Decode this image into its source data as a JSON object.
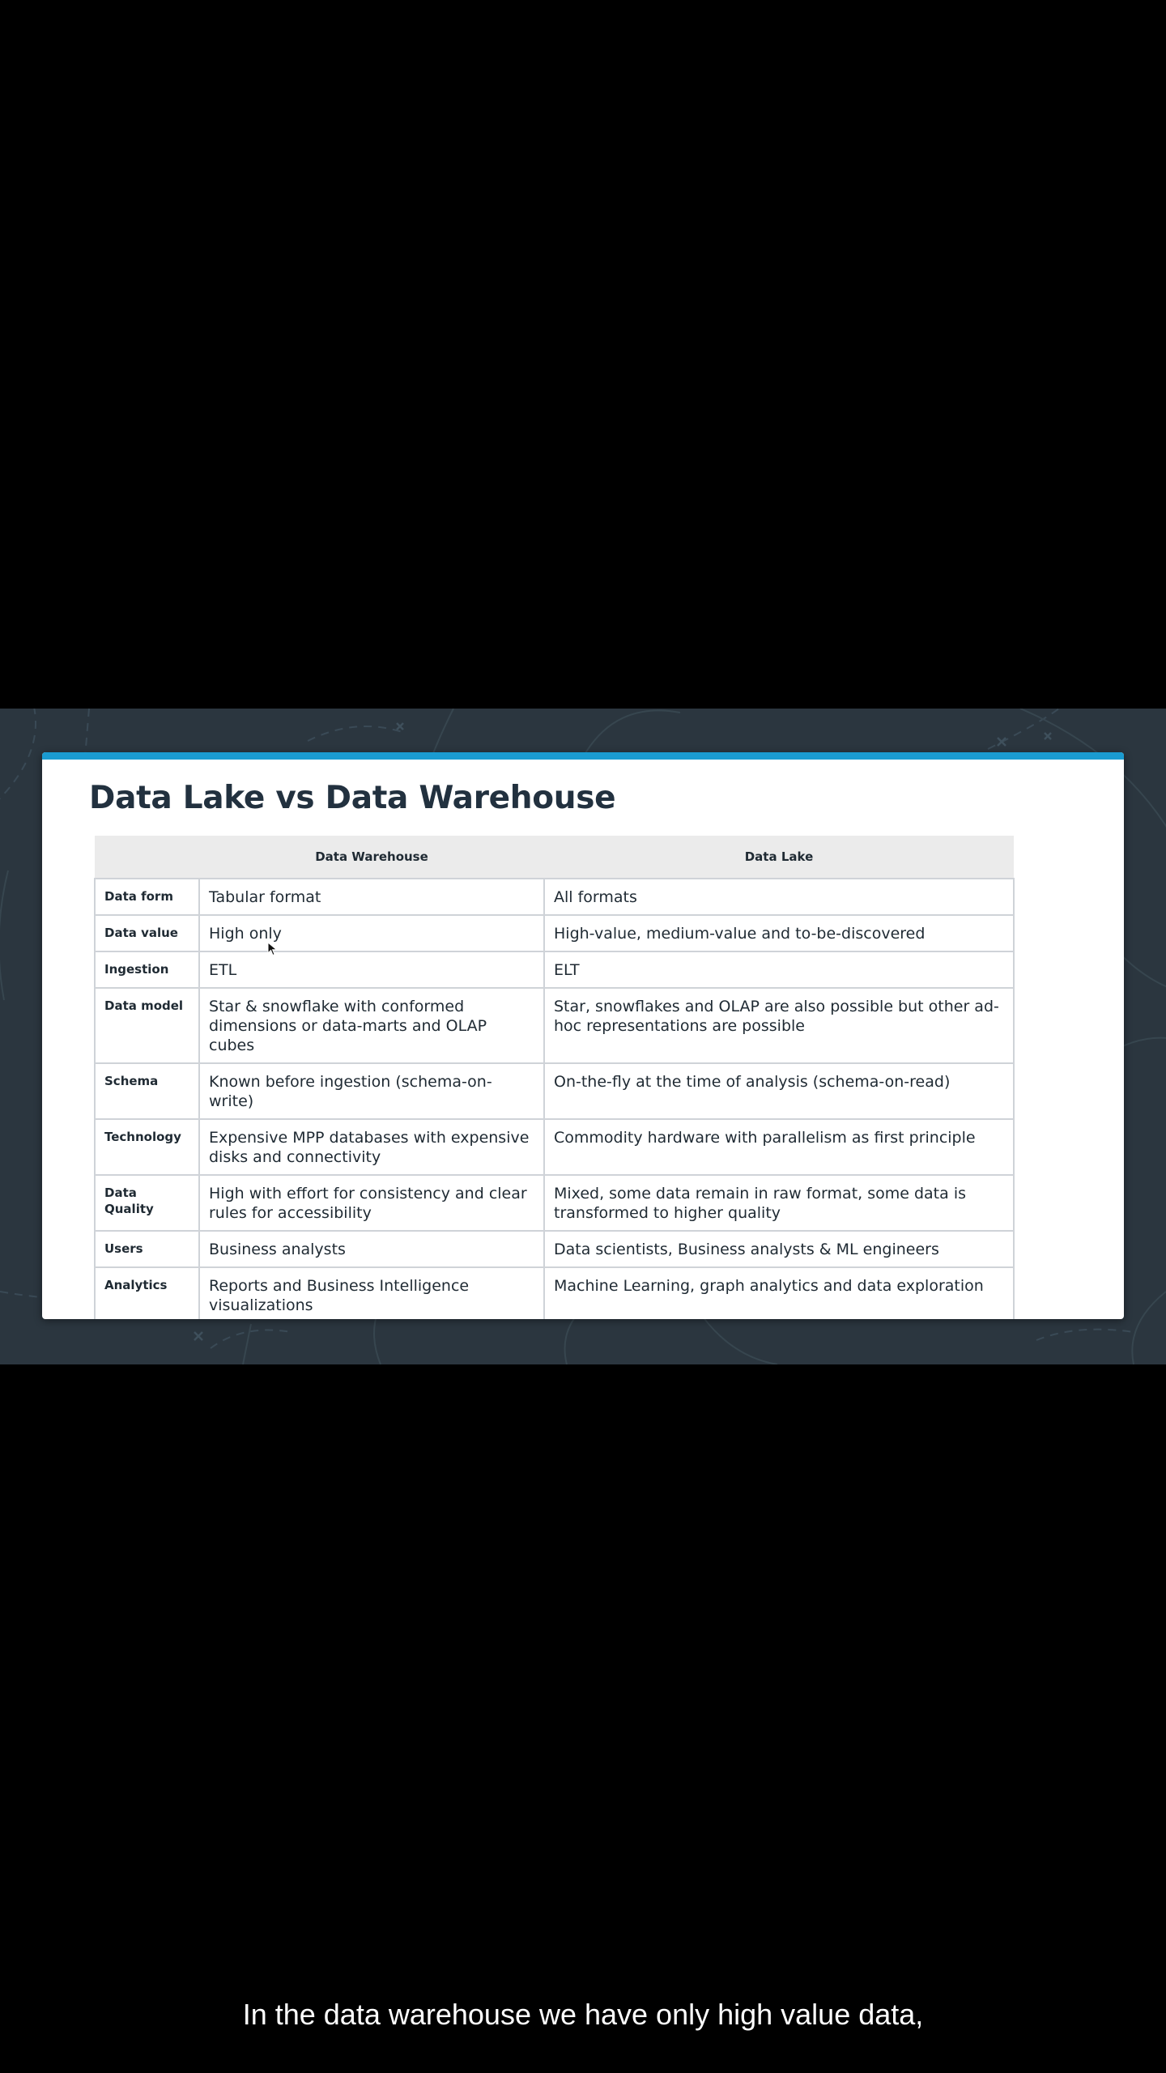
{
  "slide": {
    "title": "Data Lake vs Data Warehouse",
    "accent_color": "#1a9bd0",
    "background_color": "#2b363f"
  },
  "table": {
    "headers": [
      "",
      "Data Warehouse",
      "Data Lake"
    ],
    "rows": [
      {
        "label": "Data form",
        "warehouse": "Tabular format",
        "lake": "All formats"
      },
      {
        "label": "Data value",
        "warehouse": "High only",
        "lake": "High-value, medium-value and to-be-discovered"
      },
      {
        "label": "Ingestion",
        "warehouse": "ETL",
        "lake": "ELT"
      },
      {
        "label": "Data model",
        "warehouse": "Star & snowflake with conformed dimensions or data-marts and OLAP cubes",
        "lake": "Star, snowflakes and OLAP are also possible but other ad-hoc representations are possible"
      },
      {
        "label": "Schema",
        "warehouse": "Known before ingestion (schema-on-write)",
        "lake": "On-the-fly at the time of analysis (schema-on-read)"
      },
      {
        "label": "Technology",
        "warehouse": "Expensive MPP databases with expensive disks and connectivity",
        "lake": "Commodity hardware with parallelism as first principle"
      },
      {
        "label": "Data Quality",
        "warehouse": "High with effort for consistency and clear rules for accessibility",
        "lake": "Mixed, some data remain in raw format, some data is transformed to higher quality"
      },
      {
        "label": "Users",
        "warehouse": "Business analysts",
        "lake": "Data scientists, Business analysts & ML engineers"
      },
      {
        "label": "Analytics",
        "warehouse": "Reports and Business Intelligence visualizations",
        "lake": "Machine Learning, graph analytics and data exploration"
      }
    ]
  },
  "caption": {
    "text": "In the data warehouse we have only high value data,"
  },
  "icons": {
    "cursor": "mouse-pointer-icon"
  }
}
